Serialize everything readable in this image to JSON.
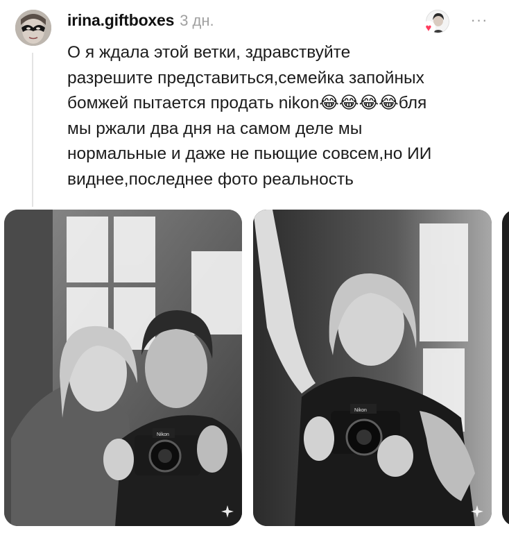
{
  "post": {
    "username": "irina.giftboxes",
    "timestamp": "3 дн.",
    "more_label": "···",
    "text": "О я ждала этой ветки, здравствуйте\nразрешите представиться,семейка запойных\nбомжей пытается продать nikon😂😂😂😂бля\nмы ржали два дня на самом деле мы\nнормальные и даже не пьющие совсем,но ИИ\nвиднее,последнее фото реальность"
  },
  "icons": {
    "avatar": "masked-woman-avatar",
    "liked_by": "liker-avatar-icon",
    "heart": "heart-icon",
    "more": "more-icon",
    "sparkle": "ai-sparkle-icon"
  },
  "photos": [
    {
      "id": "photo-1",
      "camera_brand": "Nikon"
    },
    {
      "id": "photo-2",
      "camera_brand": "Nikon"
    },
    {
      "id": "photo-3"
    }
  ],
  "colors": {
    "username": "#111111",
    "timestamp": "#a0a0a0",
    "heart": "#ff3b5c",
    "thread_line": "#e3e3e3"
  }
}
